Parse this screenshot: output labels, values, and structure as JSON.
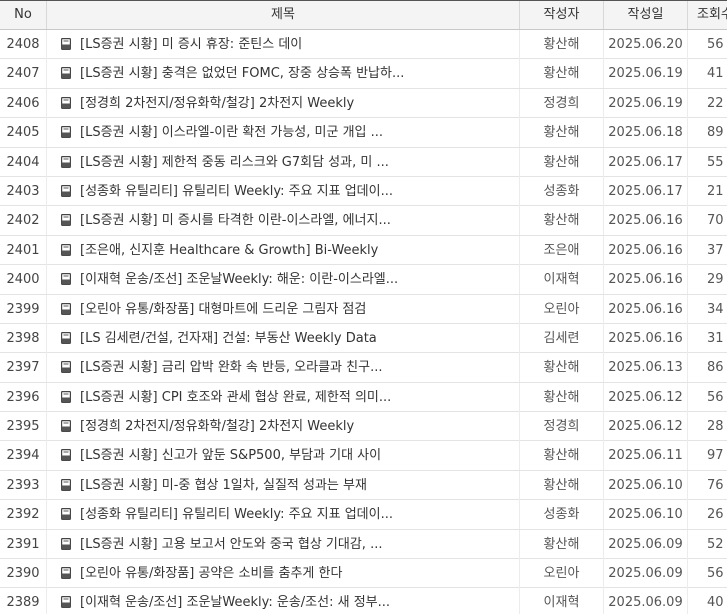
{
  "header": {
    "no": "No",
    "title": "제목",
    "author": "작성자",
    "date": "작성일",
    "views": "조회수"
  },
  "rows": [
    {
      "no": "2408",
      "title": "[LS증권 시황] 미 증시 휴장: 준틴스 데이",
      "author": "황산해",
      "date": "2025.06.20",
      "views": "56"
    },
    {
      "no": "2407",
      "title": "[LS증권 시황] 충격은 없었던 FOMC, 장중 상승폭 반납하...",
      "author": "황산해",
      "date": "2025.06.19",
      "views": "41"
    },
    {
      "no": "2406",
      "title": "[정경희 2차전지/정유화학/철강] 2차전지 Weekly",
      "author": "정경희",
      "date": "2025.06.19",
      "views": "22"
    },
    {
      "no": "2405",
      "title": "[LS증권 시황] 이스라엘-이란 확전 가능성, 미군 개입 ...",
      "author": "황산해",
      "date": "2025.06.18",
      "views": "89"
    },
    {
      "no": "2404",
      "title": "[LS증권 시황] 제한적 중동 리스크와 G7회담 성과, 미 ...",
      "author": "황산해",
      "date": "2025.06.17",
      "views": "55"
    },
    {
      "no": "2403",
      "title": "[성종화 유틸리티] 유틸리티 Weekly: 주요 지표 업데이...",
      "author": "성종화",
      "date": "2025.06.17",
      "views": "21"
    },
    {
      "no": "2402",
      "title": "[LS증권 시황] 미 증시를 타격한 이란-이스라엘, 에너지...",
      "author": "황산해",
      "date": "2025.06.16",
      "views": "70"
    },
    {
      "no": "2401",
      "title": "[조은애, 신지훈 Healthcare & Growth] Bi-Weekly",
      "author": "조은애",
      "date": "2025.06.16",
      "views": "37"
    },
    {
      "no": "2400",
      "title": "[이재혁 운송/조선] 조운날Weekly: 해운: 이란-이스라엘...",
      "author": "이재혁",
      "date": "2025.06.16",
      "views": "29"
    },
    {
      "no": "2399",
      "title": "[오린아 유통/화장품] 대형마트에 드리운 그림자 점검",
      "author": "오린아",
      "date": "2025.06.16",
      "views": "34"
    },
    {
      "no": "2398",
      "title": "[LS 김세련/건설, 건자재] 건설: 부동산 Weekly Data",
      "author": "김세련",
      "date": "2025.06.16",
      "views": "31"
    },
    {
      "no": "2397",
      "title": "[LS증권 시황] 금리 압박 완화 속 반등, 오라클과 친구...",
      "author": "황산해",
      "date": "2025.06.13",
      "views": "86"
    },
    {
      "no": "2396",
      "title": "[LS증권 시황] CPI 호조와 관세 협상 완료, 제한적 의미...",
      "author": "황산해",
      "date": "2025.06.12",
      "views": "56"
    },
    {
      "no": "2395",
      "title": "[정경희 2차전지/정유화학/철강] 2차전지 Weekly",
      "author": "정경희",
      "date": "2025.06.12",
      "views": "28"
    },
    {
      "no": "2394",
      "title": "[LS증권 시황] 신고가 앞둔 S&P500, 부담과 기대 사이",
      "author": "황산해",
      "date": "2025.06.11",
      "views": "97"
    },
    {
      "no": "2393",
      "title": "[LS증권 시황] 미-중 협상 1일차, 실질적 성과는 부재",
      "author": "황산해",
      "date": "2025.06.10",
      "views": "76"
    },
    {
      "no": "2392",
      "title": "[성종화 유틸리티] 유틸리티 Weekly: 주요 지표 업데이...",
      "author": "성종화",
      "date": "2025.06.10",
      "views": "26"
    },
    {
      "no": "2391",
      "title": "[LS증권 시황] 고용 보고서 안도와 중국 협상 기대감, ...",
      "author": "황산해",
      "date": "2025.06.09",
      "views": "52"
    },
    {
      "no": "2390",
      "title": "[오린아 유통/화장품] 공약은 소비를 춤추게 한다",
      "author": "오린아",
      "date": "2025.06.09",
      "views": "56"
    },
    {
      "no": "2389",
      "title": "[이재혁 운송/조선] 조운날Weekly: 운송/조선: 새 정부...",
      "author": "이재혁",
      "date": "2025.06.09",
      "views": "40"
    }
  ]
}
